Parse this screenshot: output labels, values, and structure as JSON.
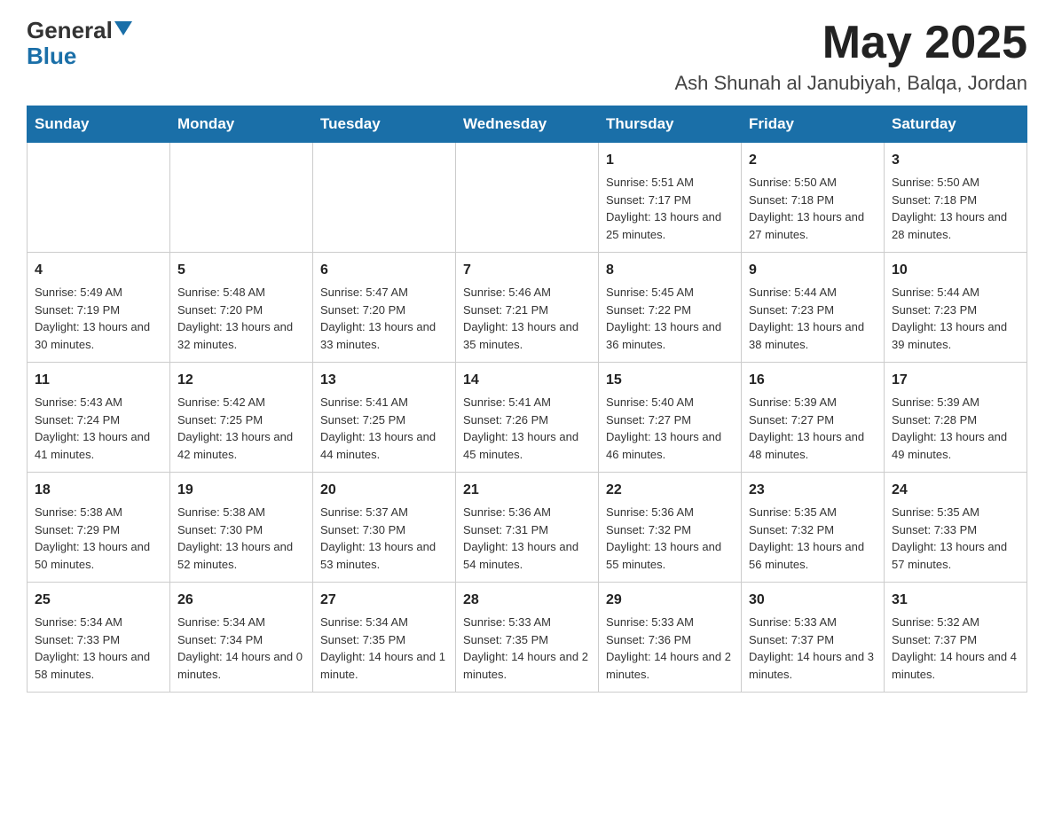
{
  "header": {
    "logo_general": "General",
    "logo_blue": "Blue",
    "month_title": "May 2025",
    "location": "Ash Shunah al Janubiyah, Balqa, Jordan"
  },
  "calendar": {
    "days_of_week": [
      "Sunday",
      "Monday",
      "Tuesday",
      "Wednesday",
      "Thursday",
      "Friday",
      "Saturday"
    ],
    "weeks": [
      [
        {
          "day": "",
          "info": ""
        },
        {
          "day": "",
          "info": ""
        },
        {
          "day": "",
          "info": ""
        },
        {
          "day": "",
          "info": ""
        },
        {
          "day": "1",
          "info": "Sunrise: 5:51 AM\nSunset: 7:17 PM\nDaylight: 13 hours and 25 minutes."
        },
        {
          "day": "2",
          "info": "Sunrise: 5:50 AM\nSunset: 7:18 PM\nDaylight: 13 hours and 27 minutes."
        },
        {
          "day": "3",
          "info": "Sunrise: 5:50 AM\nSunset: 7:18 PM\nDaylight: 13 hours and 28 minutes."
        }
      ],
      [
        {
          "day": "4",
          "info": "Sunrise: 5:49 AM\nSunset: 7:19 PM\nDaylight: 13 hours and 30 minutes."
        },
        {
          "day": "5",
          "info": "Sunrise: 5:48 AM\nSunset: 7:20 PM\nDaylight: 13 hours and 32 minutes."
        },
        {
          "day": "6",
          "info": "Sunrise: 5:47 AM\nSunset: 7:20 PM\nDaylight: 13 hours and 33 minutes."
        },
        {
          "day": "7",
          "info": "Sunrise: 5:46 AM\nSunset: 7:21 PM\nDaylight: 13 hours and 35 minutes."
        },
        {
          "day": "8",
          "info": "Sunrise: 5:45 AM\nSunset: 7:22 PM\nDaylight: 13 hours and 36 minutes."
        },
        {
          "day": "9",
          "info": "Sunrise: 5:44 AM\nSunset: 7:23 PM\nDaylight: 13 hours and 38 minutes."
        },
        {
          "day": "10",
          "info": "Sunrise: 5:44 AM\nSunset: 7:23 PM\nDaylight: 13 hours and 39 minutes."
        }
      ],
      [
        {
          "day": "11",
          "info": "Sunrise: 5:43 AM\nSunset: 7:24 PM\nDaylight: 13 hours and 41 minutes."
        },
        {
          "day": "12",
          "info": "Sunrise: 5:42 AM\nSunset: 7:25 PM\nDaylight: 13 hours and 42 minutes."
        },
        {
          "day": "13",
          "info": "Sunrise: 5:41 AM\nSunset: 7:25 PM\nDaylight: 13 hours and 44 minutes."
        },
        {
          "day": "14",
          "info": "Sunrise: 5:41 AM\nSunset: 7:26 PM\nDaylight: 13 hours and 45 minutes."
        },
        {
          "day": "15",
          "info": "Sunrise: 5:40 AM\nSunset: 7:27 PM\nDaylight: 13 hours and 46 minutes."
        },
        {
          "day": "16",
          "info": "Sunrise: 5:39 AM\nSunset: 7:27 PM\nDaylight: 13 hours and 48 minutes."
        },
        {
          "day": "17",
          "info": "Sunrise: 5:39 AM\nSunset: 7:28 PM\nDaylight: 13 hours and 49 minutes."
        }
      ],
      [
        {
          "day": "18",
          "info": "Sunrise: 5:38 AM\nSunset: 7:29 PM\nDaylight: 13 hours and 50 minutes."
        },
        {
          "day": "19",
          "info": "Sunrise: 5:38 AM\nSunset: 7:30 PM\nDaylight: 13 hours and 52 minutes."
        },
        {
          "day": "20",
          "info": "Sunrise: 5:37 AM\nSunset: 7:30 PM\nDaylight: 13 hours and 53 minutes."
        },
        {
          "day": "21",
          "info": "Sunrise: 5:36 AM\nSunset: 7:31 PM\nDaylight: 13 hours and 54 minutes."
        },
        {
          "day": "22",
          "info": "Sunrise: 5:36 AM\nSunset: 7:32 PM\nDaylight: 13 hours and 55 minutes."
        },
        {
          "day": "23",
          "info": "Sunrise: 5:35 AM\nSunset: 7:32 PM\nDaylight: 13 hours and 56 minutes."
        },
        {
          "day": "24",
          "info": "Sunrise: 5:35 AM\nSunset: 7:33 PM\nDaylight: 13 hours and 57 minutes."
        }
      ],
      [
        {
          "day": "25",
          "info": "Sunrise: 5:34 AM\nSunset: 7:33 PM\nDaylight: 13 hours and 58 minutes."
        },
        {
          "day": "26",
          "info": "Sunrise: 5:34 AM\nSunset: 7:34 PM\nDaylight: 14 hours and 0 minutes."
        },
        {
          "day": "27",
          "info": "Sunrise: 5:34 AM\nSunset: 7:35 PM\nDaylight: 14 hours and 1 minute."
        },
        {
          "day": "28",
          "info": "Sunrise: 5:33 AM\nSunset: 7:35 PM\nDaylight: 14 hours and 2 minutes."
        },
        {
          "day": "29",
          "info": "Sunrise: 5:33 AM\nSunset: 7:36 PM\nDaylight: 14 hours and 2 minutes."
        },
        {
          "day": "30",
          "info": "Sunrise: 5:33 AM\nSunset: 7:37 PM\nDaylight: 14 hours and 3 minutes."
        },
        {
          "day": "31",
          "info": "Sunrise: 5:32 AM\nSunset: 7:37 PM\nDaylight: 14 hours and 4 minutes."
        }
      ]
    ]
  }
}
